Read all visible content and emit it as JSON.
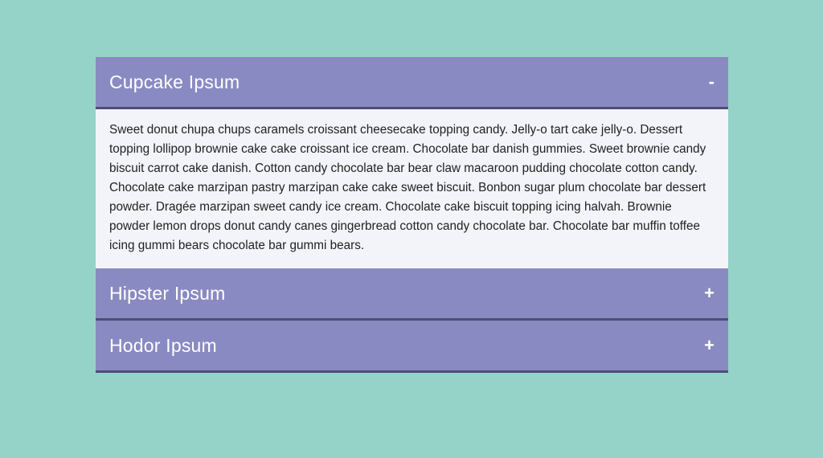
{
  "accordion": {
    "items": [
      {
        "title": "Cupcake Ipsum",
        "toggle": "-",
        "expanded": true,
        "body": "Sweet donut chupa chups caramels croissant cheesecake topping candy. Jelly-o tart cake jelly-o. Dessert topping lollipop brownie cake cake croissant ice cream. Chocolate bar danish gummies. Sweet brownie candy biscuit carrot cake danish. Cotton candy chocolate bar bear claw macaroon pudding chocolate cotton candy. Chocolate cake marzipan pastry marzipan cake cake sweet biscuit. Bonbon sugar plum chocolate bar dessert powder. Dragée marzipan sweet candy ice cream. Chocolate cake biscuit topping icing halvah. Brownie powder lemon drops donut candy canes gingerbread cotton candy chocolate bar. Chocolate bar muffin toffee icing gummi bears chocolate bar gummi bears."
      },
      {
        "title": "Hipster Ipsum",
        "toggle": "+",
        "expanded": false
      },
      {
        "title": "Hodor Ipsum",
        "toggle": "+",
        "expanded": false
      }
    ]
  },
  "colors": {
    "page_background": "#95d2c7",
    "header_background": "#8a8ac3",
    "header_border": "#4d4d77",
    "panel_background": "#f3f4fa",
    "header_text": "#ffffff",
    "body_text": "#222222"
  }
}
